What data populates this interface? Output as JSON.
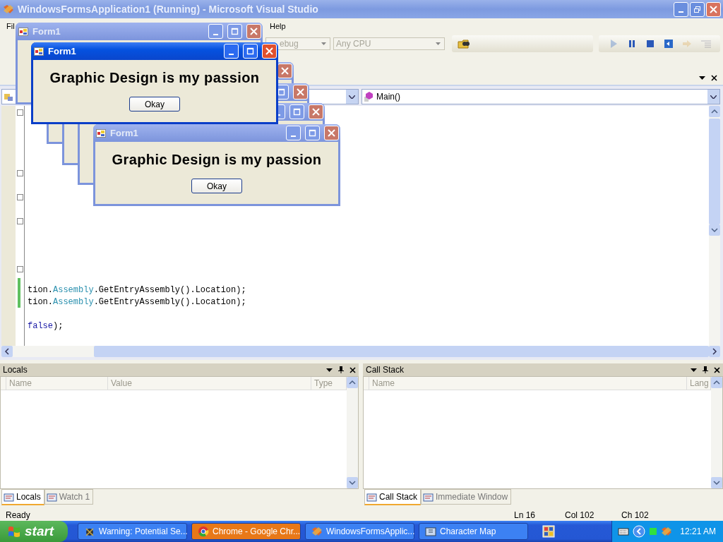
{
  "ide": {
    "title": "WindowsFormsApplication1 (Running) - Microsoft Visual Studio",
    "menu": [
      {
        "label": "Fil"
      },
      {
        "label": "Help"
      }
    ],
    "toolbar": {
      "configuration": "ebug",
      "platform": "Any CPU",
      "debug_buttons": [
        {
          "kind": "play",
          "disabled": true
        },
        {
          "kind": "pause",
          "disabled": false
        },
        {
          "kind": "stop",
          "disabled": false
        },
        {
          "kind": "restart",
          "disabled": false
        },
        {
          "kind": "step",
          "disabled": true
        },
        {
          "kind": "stack",
          "disabled": true
        }
      ]
    },
    "editor": {
      "member": "Main()",
      "code": [
        {
          "blank_before": false,
          "tokens": [
            {
              "kind": "plain",
              "text": "tion."
            },
            {
              "kind": "type",
              "text": "Assembly"
            },
            {
              "kind": "plain",
              "text": ".GetEntryAssembly().Location);"
            }
          ]
        },
        {
          "blank_before": false,
          "tokens": [
            {
              "kind": "plain",
              "text": "tion."
            },
            {
              "kind": "type",
              "text": "Assembly"
            },
            {
              "kind": "plain",
              "text": ".GetEntryAssembly().Location);"
            }
          ]
        },
        {
          "blank_before": true,
          "tokens": [
            {
              "kind": "keyword",
              "text": "false"
            },
            {
              "kind": "plain",
              "text": ");"
            }
          ]
        }
      ]
    },
    "panels": [
      {
        "title": "Locals",
        "columns": [
          "Name",
          "Value",
          "Type"
        ],
        "tabs": [
          {
            "label": "Locals",
            "selected": true
          },
          {
            "label": "Watch 1",
            "selected": false
          }
        ]
      },
      {
        "title": "Call Stack",
        "columns": [
          "Name",
          "Lang"
        ],
        "tabs": [
          {
            "label": "Call Stack",
            "selected": true
          },
          {
            "label": "Immediate Window",
            "selected": false
          }
        ]
      }
    ],
    "status_bar": {
      "message": "Ready",
      "line": "Ln 16",
      "column": "Col 102",
      "char": "Ch 102"
    }
  },
  "dialogs": [
    {
      "kind": "titled",
      "title": "Form1",
      "active": false
    },
    {
      "kind": "full",
      "title": "Form1",
      "message": "Graphic Design is my passion",
      "button": "Okay",
      "active": true
    },
    {
      "kind": "covered",
      "active": false
    },
    {
      "kind": "covered",
      "active": false
    },
    {
      "kind": "covered",
      "active": false
    },
    {
      "kind": "full",
      "title": "Form1",
      "message": "Graphic Design is my passion",
      "button": "Okay",
      "active": false
    }
  ],
  "taskbar": {
    "start": "start",
    "tasks": [
      {
        "kind": "warning",
        "label": "Warning: Potential Se...",
        "highlighted": false
      },
      {
        "kind": "browser",
        "label": "Chrome - Google Chr...",
        "highlighted": true
      },
      {
        "kind": "studio",
        "label": "WindowsFormsApplic...",
        "highlighted": false
      },
      {
        "kind": "charmap",
        "label": "Character Map",
        "highlighted": false
      }
    ],
    "clock": "12:21 AM"
  }
}
